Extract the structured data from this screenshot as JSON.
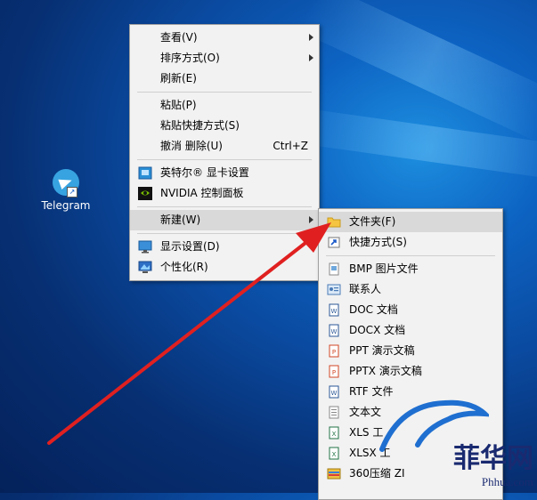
{
  "desktop": {
    "icons": [
      {
        "label": "Telegram"
      }
    ]
  },
  "context_menu": {
    "items": [
      {
        "label": "查看(V)",
        "has_submenu": true
      },
      {
        "label": "排序方式(O)",
        "has_submenu": true
      },
      {
        "label": "刷新(E)"
      },
      {
        "label": "粘贴(P)"
      },
      {
        "label": "粘贴快捷方式(S)"
      },
      {
        "label": "撤消 删除(U)",
        "shortcut": "Ctrl+Z"
      },
      {
        "label": "英特尔® 显卡设置",
        "icon": "intel-graphics-icon"
      },
      {
        "label": "NVIDIA 控制面板",
        "icon": "nvidia-icon"
      },
      {
        "label": "新建(W)",
        "has_submenu": true,
        "highlighted": true
      },
      {
        "label": "显示设置(D)",
        "icon": "display-settings-icon"
      },
      {
        "label": "个性化(R)",
        "icon": "personalize-icon"
      }
    ]
  },
  "new_submenu": {
    "items": [
      {
        "label": "文件夹(F)",
        "icon": "folder-icon",
        "highlighted": true
      },
      {
        "label": "快捷方式(S)",
        "icon": "shortcut-icon"
      },
      {
        "label": "BMP 图片文件",
        "icon": "bmp-file-icon"
      },
      {
        "label": "联系人",
        "icon": "contact-icon"
      },
      {
        "label": "DOC 文档",
        "icon": "doc-file-icon"
      },
      {
        "label": "DOCX 文档",
        "icon": "docx-file-icon"
      },
      {
        "label": "PPT 演示文稿",
        "icon": "ppt-file-icon"
      },
      {
        "label": "PPTX 演示文稿",
        "icon": "pptx-file-icon"
      },
      {
        "label": "RTF 文件",
        "icon": "rtf-file-icon"
      },
      {
        "label": "文本文",
        "icon": "txt-file-icon"
      },
      {
        "label": "XLS 工",
        "icon": "xls-file-icon"
      },
      {
        "label": "XLSX 工",
        "icon": "xlsx-file-icon"
      },
      {
        "label": "360压缩 ZI",
        "icon": "zip-file-icon"
      }
    ]
  },
  "watermark": {
    "brand": "菲华网",
    "url": "Phhua.com"
  },
  "colors": {
    "annotation_arrow": "#e02020",
    "menu_bg": "#f2f2f2",
    "highlight": "#d9d9d9"
  }
}
